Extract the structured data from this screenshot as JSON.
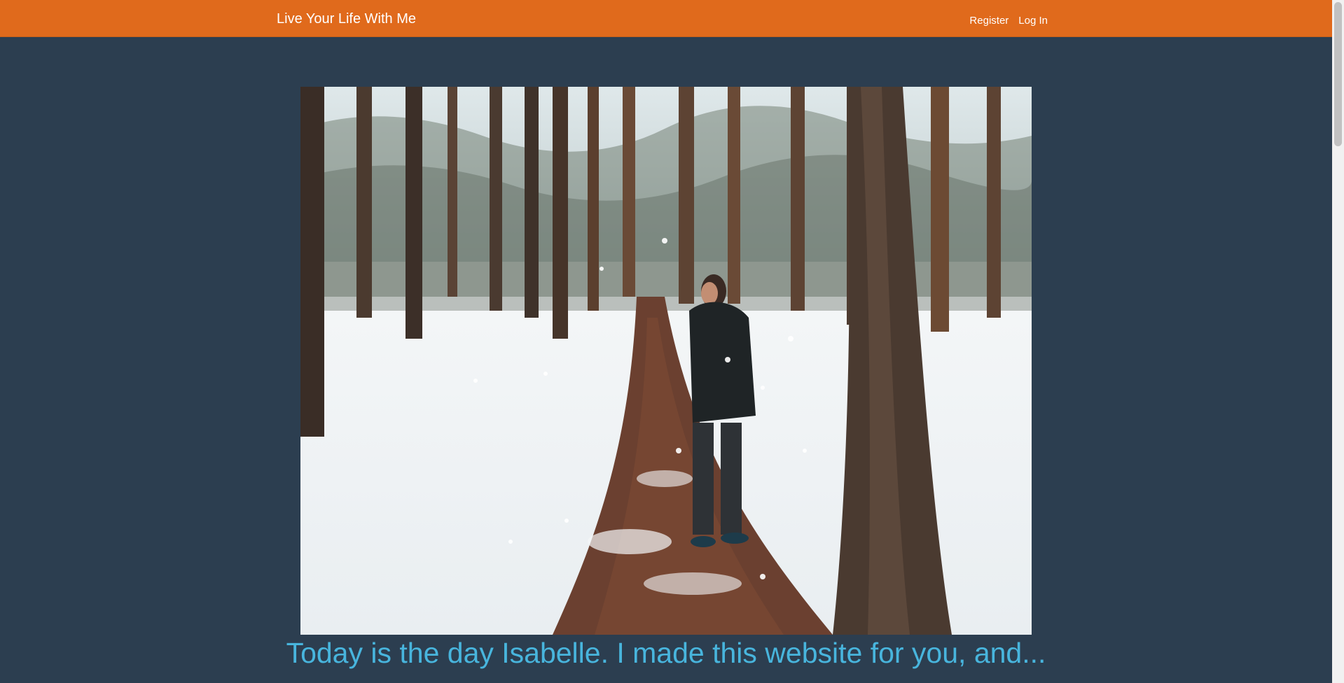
{
  "navbar": {
    "brand": "Live Your Life With Me",
    "links": [
      "Register",
      "Log In"
    ]
  },
  "hero": {
    "image_alt": "person-in-snowy-forest"
  },
  "caption": {
    "text": "Today is the day Isabelle. I made this website for you, and..."
  },
  "colors": {
    "navbar_bg": "#e06a1c",
    "page_bg": "#2c3e50",
    "caption_color": "#48b5dd"
  }
}
